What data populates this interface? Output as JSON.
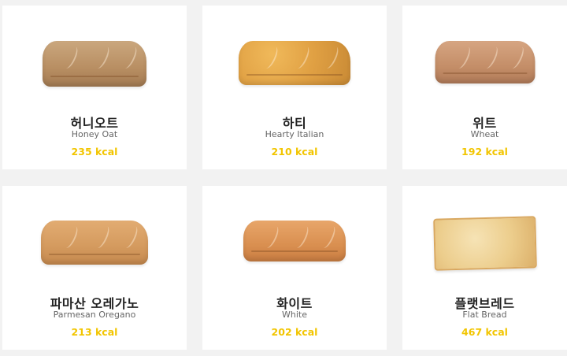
{
  "colors": {
    "kcal": "#f2c500",
    "background": "#f2f2f2",
    "card": "#ffffff"
  },
  "breads": [
    {
      "korean": "허니오트",
      "english": "Honey Oat",
      "kcal": "235 kcal",
      "icon": "honey-oat-bread-image"
    },
    {
      "korean": "하티",
      "english": "Hearty Italian",
      "kcal": "210 kcal",
      "icon": "hearty-italian-bread-image"
    },
    {
      "korean": "위트",
      "english": "Wheat",
      "kcal": "192 kcal",
      "icon": "wheat-bread-image"
    },
    {
      "korean": "파마산 오레가노",
      "english": "Parmesan Oregano",
      "kcal": "213 kcal",
      "icon": "parmesan-oregano-bread-image"
    },
    {
      "korean": "화이트",
      "english": "White",
      "kcal": "202 kcal",
      "icon": "white-bread-image"
    },
    {
      "korean": "플랫브레드",
      "english": "Flat Bread",
      "kcal": "467 kcal",
      "icon": "flat-bread-image"
    }
  ]
}
